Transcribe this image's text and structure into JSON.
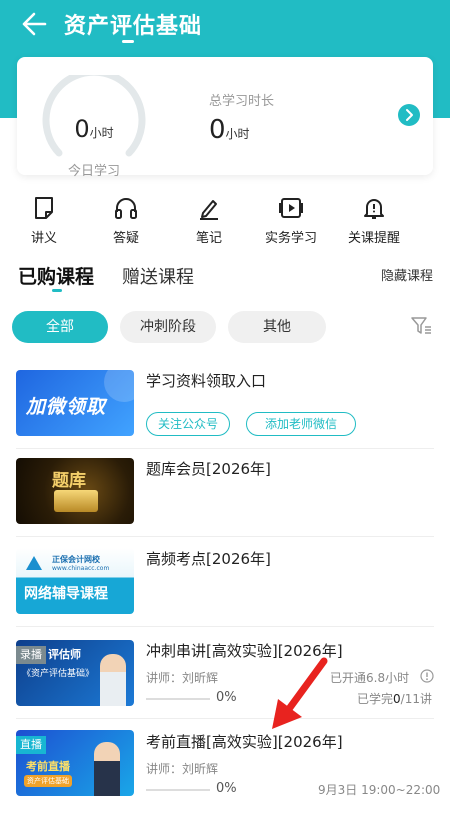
{
  "header": {
    "title": "资产评估基础"
  },
  "stats": {
    "today_value": "0",
    "today_unit": "小时",
    "today_label": "今日学习",
    "total_label": "总学习时长",
    "total_value": "0",
    "total_unit": "小时"
  },
  "features": [
    {
      "label": "讲义",
      "icon": "document-icon"
    },
    {
      "label": "答疑",
      "icon": "headphones-icon"
    },
    {
      "label": "笔记",
      "icon": "pen-icon"
    },
    {
      "label": "实务学习",
      "icon": "play-icon"
    },
    {
      "label": "关课提醒",
      "icon": "bell-icon"
    }
  ],
  "tabs": {
    "bought": "已购课程",
    "gift": "赠送课程",
    "hide": "隐藏课程"
  },
  "filters": {
    "all": "全部",
    "sprint": "冲刺阶段",
    "other": "其他",
    "selected": "全部"
  },
  "courses": [
    {
      "title": "学习资料领取入口",
      "thumb_text": "加微领取",
      "tags": [
        "关注公众号",
        "添加老师微信"
      ]
    },
    {
      "title": "题库会员[2026年]",
      "thumb_text": "题库"
    },
    {
      "title": "高频考点[2026年]",
      "thumb_brand": "正保会计网校",
      "thumb_url": "www.chinaacc.com",
      "thumb_text": "网络辅导课程"
    },
    {
      "title": "冲刺串讲[高效实验][2026年]",
      "badge": "录播",
      "thumb_line1": "评估师",
      "thumb_line2": "《资产评估基础》",
      "teacher": "讲师：刘昕辉",
      "progress": "0%",
      "opened": "已开通6.8小时",
      "completed_prefix": "已学完",
      "completed_value": "0",
      "completed_suffix": "/11讲"
    },
    {
      "title": "考前直播[高效实验][2026年]",
      "badge": "直播",
      "thumb_line1": "考前直播",
      "thumb_line2": "资产评估基础",
      "teacher": "讲师：刘昕辉",
      "progress": "0%",
      "schedule": "9月3日 19:00~22:00"
    }
  ],
  "colors": {
    "accent": "#21bcc4",
    "annotation_arrow": "#e8231f"
  }
}
